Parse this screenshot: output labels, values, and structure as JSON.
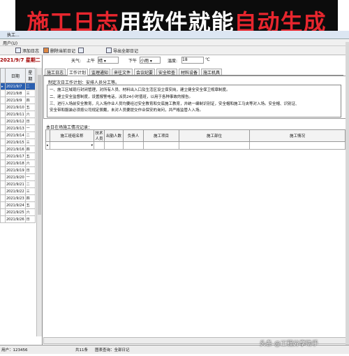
{
  "banner": {
    "part1": "施工日志",
    "part2": "用软件就能",
    "part3": "自动生成"
  },
  "window": {
    "title": "执工..."
  },
  "menu": {
    "label": "用户(U)"
  },
  "toolbar": [
    {
      "label": "添加日志"
    },
    {
      "label": "删除当前日记"
    },
    {
      "label": ""
    },
    {
      "label": "导出全部日记"
    }
  ],
  "sidebar": {
    "current_date": "2021/9/7  星期二",
    "col_date": "日期",
    "col_day": "星期",
    "rows": [
      {
        "date": "2021/9/7",
        "day": "二"
      },
      {
        "date": "2021/9/8",
        "day": "三"
      },
      {
        "date": "2021/9/9",
        "day": "四"
      },
      {
        "date": "2021/9/10",
        "day": "五"
      },
      {
        "date": "2021/9/11",
        "day": "六"
      },
      {
        "date": "2021/9/12",
        "day": "日"
      },
      {
        "date": "2021/9/13",
        "day": "一"
      },
      {
        "date": "2021/9/14",
        "day": "二"
      },
      {
        "date": "2021/9/15",
        "day": "三"
      },
      {
        "date": "2021/9/16",
        "day": "四"
      },
      {
        "date": "2021/9/17",
        "day": "五"
      },
      {
        "date": "2021/9/18",
        "day": "六"
      },
      {
        "date": "2021/9/19",
        "day": "日"
      },
      {
        "date": "2021/9/20",
        "day": "一"
      },
      {
        "date": "2021/9/21",
        "day": "二"
      },
      {
        "date": "2021/9/22",
        "day": "三"
      },
      {
        "date": "2021/9/23",
        "day": "四"
      },
      {
        "date": "2021/9/24",
        "day": "五"
      },
      {
        "date": "2021/9/25",
        "day": "六"
      },
      {
        "date": "2021/9/26",
        "day": "日"
      }
    ]
  },
  "weather": {
    "label": "天气:",
    "am": "上午",
    "am_val": "晴",
    "pm": "下午",
    "pm_val": "小雨",
    "temp_label": "温度:",
    "temp_val": "18",
    "unit": "℃"
  },
  "tabs": [
    "施工日志",
    "工作计划",
    "监理通知",
    "来往文件",
    "会议纪要",
    "安全检查",
    "材料设备",
    "施工机具"
  ],
  "content": {
    "line1": "制定次日工作计划：安排人员分工等。",
    "paras": [
      "一、施工区域现行封闭管理，对所有人员、材料出入口及生活区设立保安岗，建立健全安全保卫规章制度。",
      "    二、建立安全监督制度，设置报警电话，派员24小时值班，以用于各种事故的报告。",
      "    三、进行入场前安全教育，凡入场作业人员均要经过安全教育和交底施工教育，并统一编制识别证，安全帽和施工马夹等对入场。安全帽、识别证、",
      "安全带和服装必须按公司规定佩戴，未对人员要提交作业保安的询问，并严格监管人入场。"
    ]
  },
  "grid": {
    "label": "本日在场施工情况记录：",
    "headers": [
      "施工班组名称",
      "技术人员",
      "出勤人数",
      "负责人",
      "施工项目",
      "施工部位",
      "施工情况"
    ]
  },
  "status": {
    "user": "用户：123456",
    "count": "共11条",
    "scope": "图表查询：全部日记"
  },
  "watermark": "头条 @工程分享助手"
}
